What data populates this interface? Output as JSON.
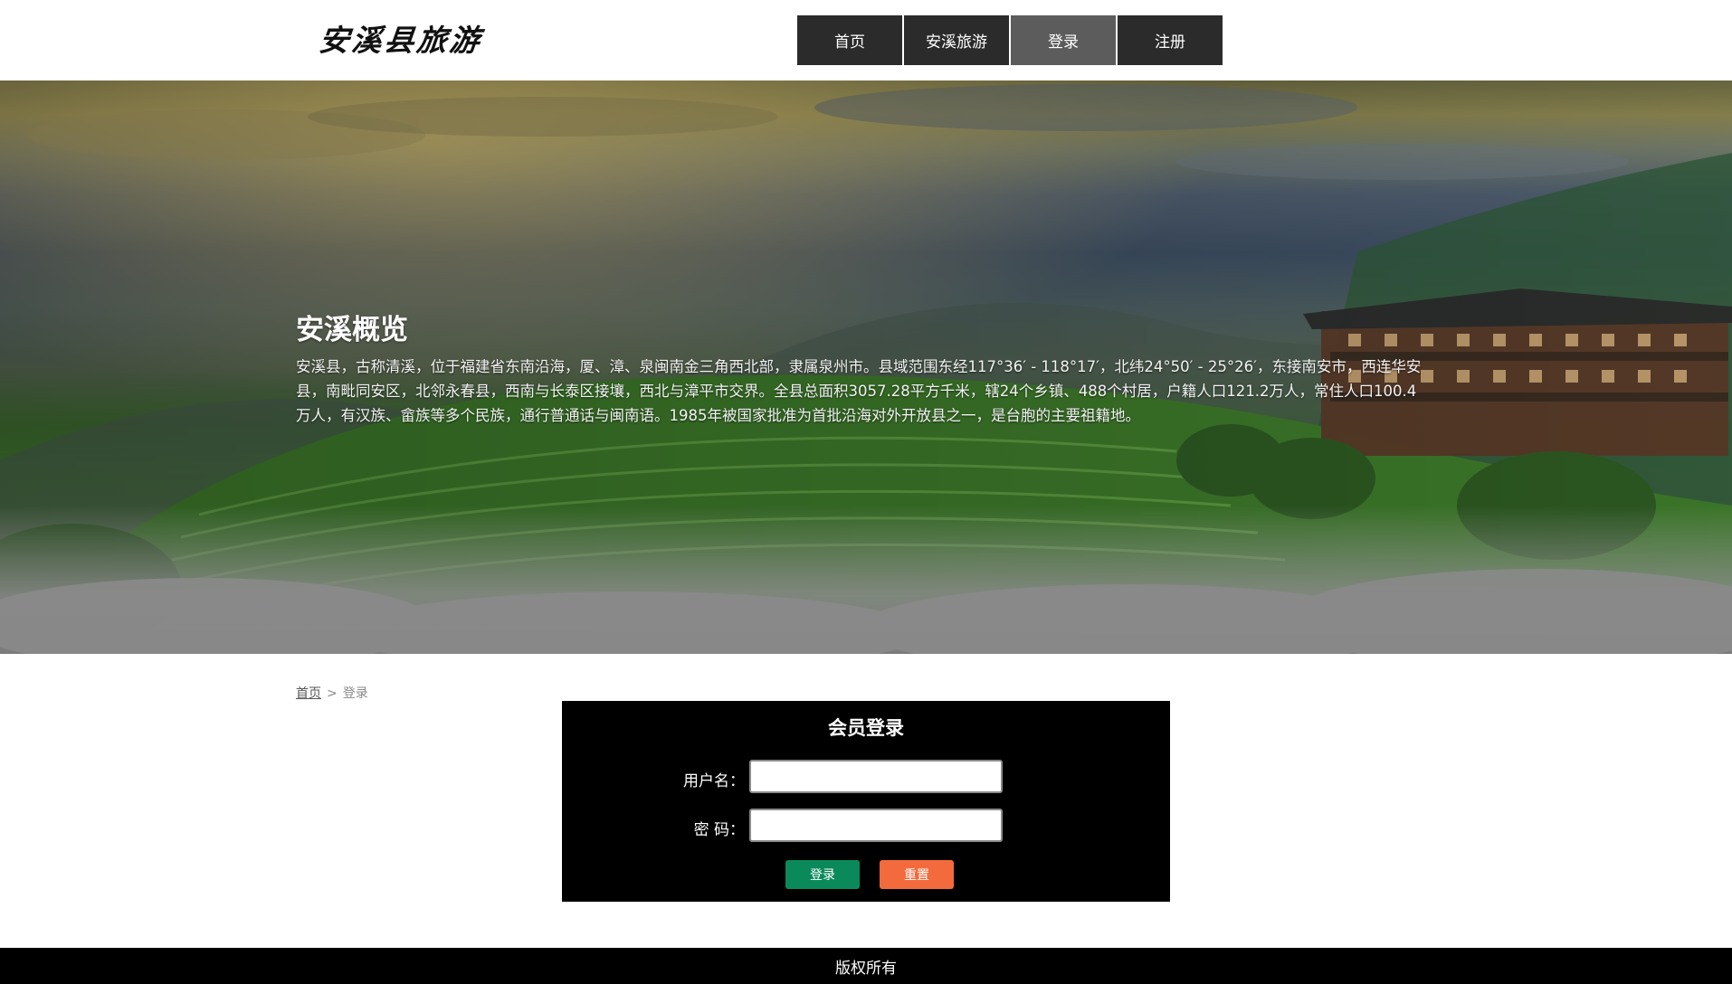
{
  "header": {
    "logo_text": "安溪县旅游",
    "nav": [
      {
        "label": "首页",
        "active": false
      },
      {
        "label": "安溪旅游",
        "active": false
      },
      {
        "label": "登录",
        "active": true
      },
      {
        "label": "注册",
        "active": false
      }
    ]
  },
  "hero": {
    "title": "安溪概览",
    "text": "安溪县，古称清溪，位于福建省东南沿海，厦、漳、泉闽南金三角西北部，隶属泉州市。县域范围东经117°36′ - 118°17′，北纬24°50′ - 25°26′，东接南安市，西连华安县，南毗同安区，北邻永春县，西南与长泰区接壤，西北与漳平市交界。全县总面积3057.28平方千米，辖24个乡镇、488个村居，户籍人口121.2万人，常住人口100.4万人，有汉族、畲族等多个民族，通行普通话与闽南语。1985年被国家批准为首批沿海对外开放县之一，是台胞的主要祖籍地。"
  },
  "breadcrumb": {
    "home": "首页",
    "separator": ">",
    "current": "登录"
  },
  "login": {
    "title": "会员登录",
    "username_label": "用户名：",
    "username_value": "",
    "password_label": "密 码：",
    "password_value": "",
    "login_button": "登录",
    "reset_button": "重置",
    "login_color": "#0a8a5a",
    "reset_color": "#f36a3c"
  },
  "footer": {
    "text": "版权所有"
  }
}
